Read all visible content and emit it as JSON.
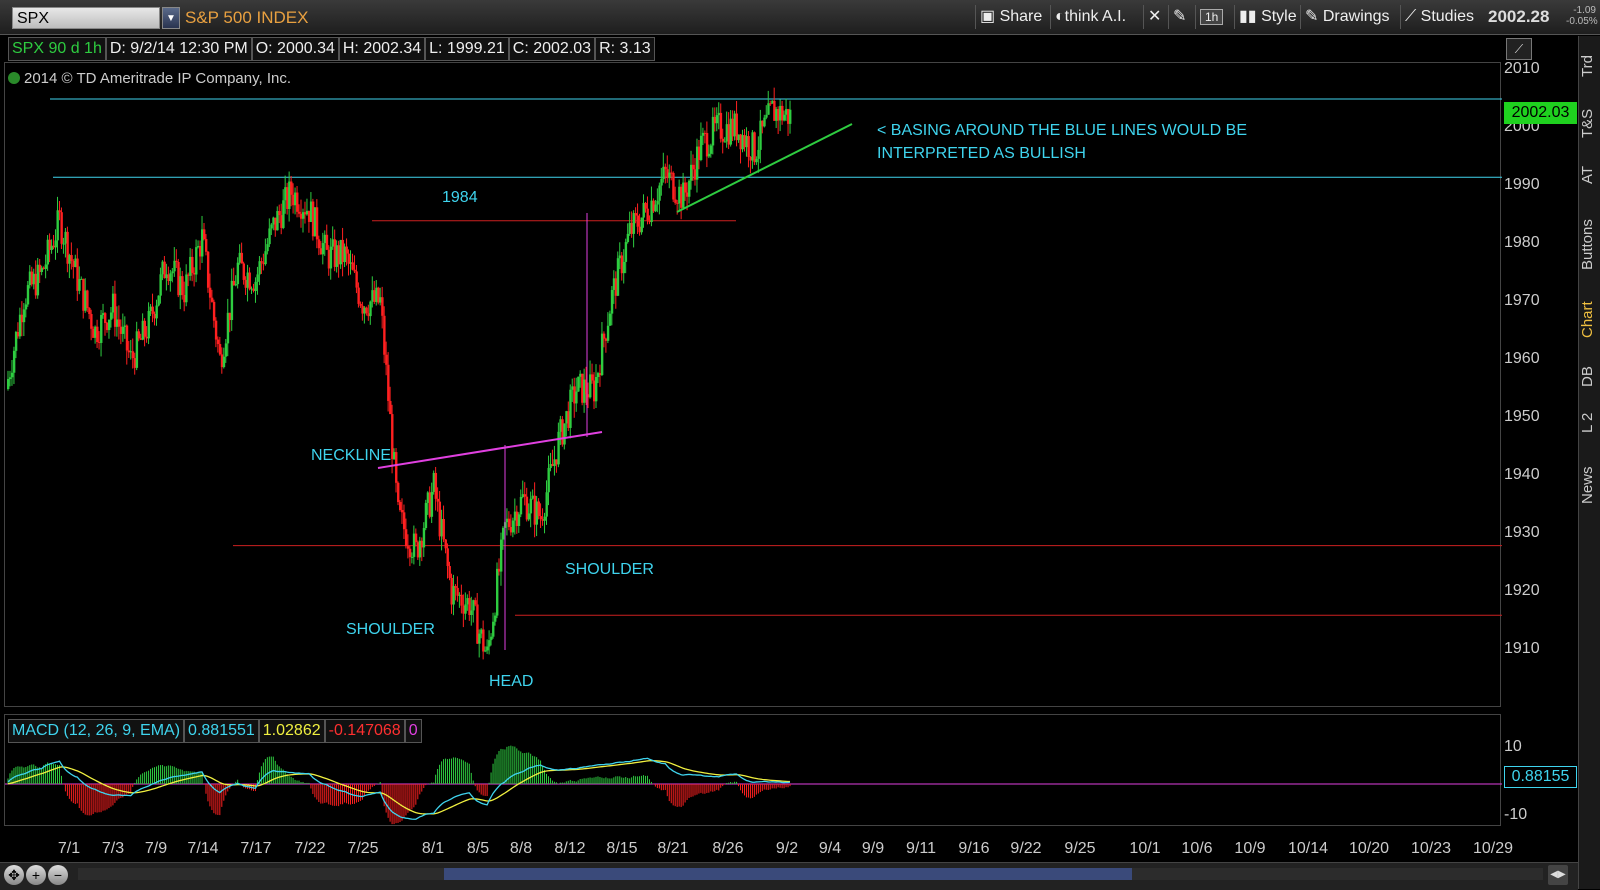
{
  "toolbar": {
    "symbol": "SPX",
    "symbol_name": "S&P 500 INDEX",
    "share": "Share",
    "think_ai": "think A.I.",
    "interval": "1h",
    "style": "Style",
    "drawings": "Drawings",
    "studies": "Studies",
    "last_price": "2002.28",
    "change": "-1.09",
    "change_pct": "-0.05%"
  },
  "info": {
    "symbol": "SPX 90 d 1h",
    "date": "D: 9/2/14 12:30 PM",
    "open": "O: 2000.34",
    "high": "H: 2002.34",
    "low": "L: 1999.21",
    "close": "C: 2002.03",
    "range": "R: 3.13"
  },
  "copyright": "2014 © TD Ameritrade IP Company, Inc.",
  "sidebar_tabs": [
    "Trd",
    "T&S",
    "AT",
    "Buttons",
    "Chart",
    "DB",
    "L 2",
    "News"
  ],
  "annotations": {
    "basing_line1": "< BASING AROUND THE BLUE LINES WOULD BE",
    "basing_line2": "INTERPRETED AS BULLISH",
    "level_1984": "1984",
    "neckline": "NECKLINE",
    "shoulder_left": "SHOULDER",
    "shoulder_right": "SHOULDER",
    "head": "HEAD"
  },
  "price_axis": [
    "2010",
    "2000",
    "1990",
    "1980",
    "1970",
    "1960",
    "1950",
    "1940",
    "1930",
    "1920",
    "1910"
  ],
  "current_price_label": "2002.03",
  "macd": {
    "label": "MACD (12, 26, 9, EMA)",
    "value": "0.881551",
    "avg": "1.02862",
    "diff": "-0.147068",
    "zero": "0",
    "axis_top": "10",
    "axis_bottom": "-10",
    "current_label": "0.88155"
  },
  "date_axis": [
    "7/1",
    "7/3",
    "7/9",
    "7/14",
    "7/17",
    "7/22",
    "7/25",
    "8/1",
    "8/5",
    "8/8",
    "8/12",
    "8/15",
    "8/21",
    "8/26",
    "9/2",
    "9/4",
    "9/9",
    "9/11",
    "9/16",
    "9/22",
    "9/25",
    "10/1",
    "10/6",
    "10/9",
    "10/14",
    "10/20",
    "10/23",
    "10/29"
  ],
  "colors": {
    "up_candle": "#2ecc40",
    "down_candle": "#ff2020",
    "annotation": "#3fd4ee",
    "neckline": "#e040e0",
    "support_line": "#2ecc40",
    "resistance_red": "#cc2020"
  },
  "chart_data": {
    "type": "candlestick",
    "symbol": "SPX",
    "ylim": [
      1900,
      2012
    ],
    "close_path": [
      [
        "6/30",
        1955
      ],
      [
        "7/1",
        1971
      ],
      [
        "7/2",
        1975
      ],
      [
        "7/3",
        1984
      ],
      [
        "7/7",
        1974
      ],
      [
        "7/8",
        1965
      ],
      [
        "7/9",
        1969
      ],
      [
        "7/10",
        1960
      ],
      [
        "7/11",
        1966
      ],
      [
        "7/14",
        1977
      ],
      [
        "7/15",
        1972
      ],
      [
        "7/16",
        1981
      ],
      [
        "7/17",
        1960
      ],
      [
        "7/18",
        1976
      ],
      [
        "7/21",
        1974
      ],
      [
        "7/22",
        1983
      ],
      [
        "7/23",
        1989
      ],
      [
        "7/24",
        1986
      ],
      [
        "7/25",
        1978
      ],
      [
        "7/28",
        1978
      ],
      [
        "7/29",
        1970
      ],
      [
        "7/30",
        1970
      ],
      [
        "7/31",
        1933
      ],
      [
        "8/1",
        1927
      ],
      [
        "8/4",
        1938
      ],
      [
        "8/5",
        1920
      ],
      [
        "8/6",
        1918
      ],
      [
        "8/7",
        1909
      ],
      [
        "8/8",
        1931
      ],
      [
        "8/11",
        1936
      ],
      [
        "8/12",
        1933
      ],
      [
        "8/13",
        1946
      ],
      [
        "8/14",
        1955
      ],
      [
        "8/15",
        1955
      ],
      [
        "8/18",
        1971
      ],
      [
        "8/19",
        1982
      ],
      [
        "8/20",
        1986
      ],
      [
        "8/21",
        1992
      ],
      [
        "8/22",
        1988
      ],
      [
        "8/25",
        1997
      ],
      [
        "8/26",
        2000
      ],
      [
        "8/27",
        2000
      ],
      [
        "8/28",
        1996
      ],
      [
        "8/29",
        2003
      ],
      [
        "9/2",
        2002.03
      ]
    ],
    "annotations_levels": {
      "blue_upper": 2005,
      "blue_lower": 1991.5,
      "red_1984": 1984,
      "red_1928": 1928,
      "red_1916": 1916
    },
    "macd_series": {
      "name": "MACD (12, 26, 9, EMA)",
      "value": 0.881551,
      "avg": 1.02862,
      "diff": -0.147068
    }
  }
}
